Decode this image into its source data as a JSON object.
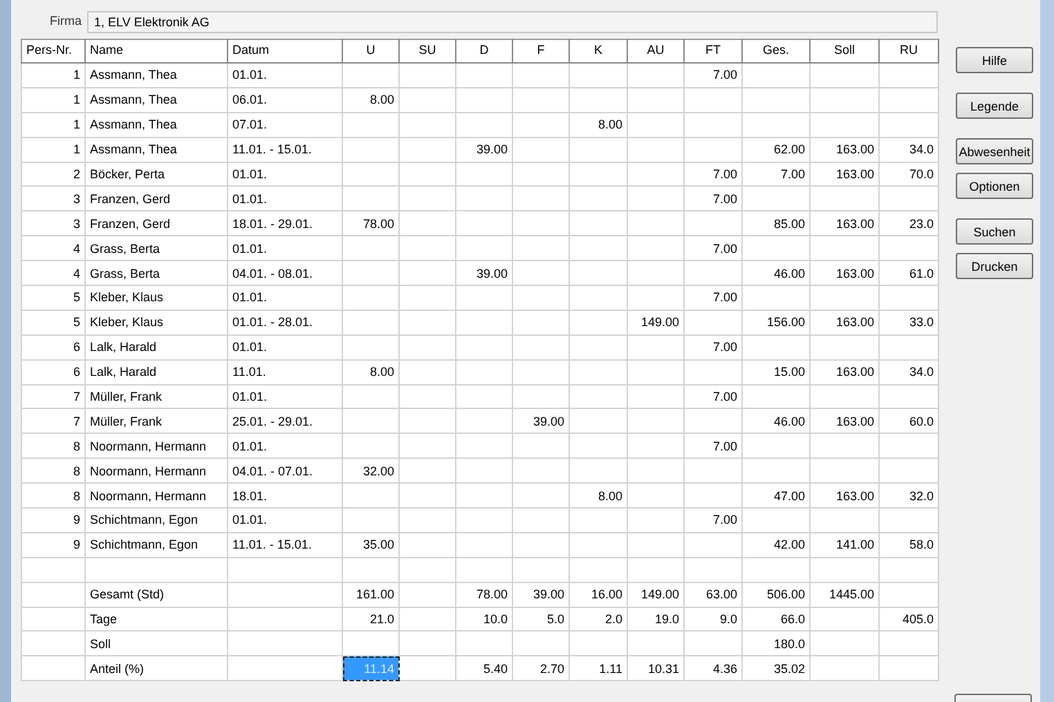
{
  "firma": {
    "label": "Firma",
    "value": "1, ELV Elektronik AG"
  },
  "table": {
    "columns": [
      "Pers-Nr.",
      "Name",
      "Datum",
      "U",
      "SU",
      "D",
      "F",
      "K",
      "AU",
      "FT",
      "Ges.",
      "Soll",
      "RU"
    ],
    "rows": [
      {
        "cells": [
          {
            "text": "1",
            "selected": false
          },
          {
            "text": "Assmann, Thea",
            "selected": false
          },
          {
            "text": "01.01.",
            "selected": false
          },
          {
            "selected": false
          },
          {
            "selected": false
          },
          {
            "selected": false
          },
          {
            "selected": false
          },
          {
            "selected": false
          },
          {
            "selected": false
          },
          {
            "text": "7.00",
            "selected": false
          },
          {
            "selected": false
          },
          {
            "selected": false
          },
          {
            "selected": false
          }
        ]
      },
      {
        "cells": [
          {
            "text": "1",
            "selected": false
          },
          {
            "text": "Assmann, Thea",
            "selected": false
          },
          {
            "text": "06.01.",
            "selected": false
          },
          {
            "text": "8.00",
            "selected": false
          },
          {
            "selected": false
          },
          {
            "selected": false
          },
          {
            "selected": false
          },
          {
            "selected": false
          },
          {
            "selected": false
          },
          {
            "selected": false
          },
          {
            "selected": false
          },
          {
            "selected": false
          },
          {
            "selected": false
          }
        ]
      },
      {
        "cells": [
          {
            "text": "1",
            "selected": false
          },
          {
            "text": "Assmann, Thea",
            "selected": false
          },
          {
            "text": "07.01.",
            "selected": false
          },
          {
            "selected": false
          },
          {
            "selected": false
          },
          {
            "selected": false
          },
          {
            "selected": false
          },
          {
            "text": "8.00",
            "selected": false
          },
          {
            "selected": false
          },
          {
            "selected": false
          },
          {
            "selected": false
          },
          {
            "selected": false
          },
          {
            "selected": false
          }
        ]
      },
      {
        "cells": [
          {
            "text": "1",
            "selected": false
          },
          {
            "text": "Assmann, Thea",
            "selected": false
          },
          {
            "text": "11.01. - 15.01.",
            "selected": false
          },
          {
            "selected": false
          },
          {
            "selected": false
          },
          {
            "text": "39.00",
            "selected": false
          },
          {
            "selected": false
          },
          {
            "selected": false
          },
          {
            "selected": false
          },
          {
            "selected": false
          },
          {
            "text": "62.00",
            "selected": false
          },
          {
            "text": "163.00",
            "selected": false
          },
          {
            "text": "34.0",
            "selected": false
          }
        ]
      },
      {
        "cells": [
          {
            "text": "2",
            "selected": false
          },
          {
            "text": "Böcker, Perta",
            "selected": false
          },
          {
            "text": "01.01.",
            "selected": false
          },
          {
            "selected": false
          },
          {
            "selected": false
          },
          {
            "selected": false
          },
          {
            "selected": false
          },
          {
            "selected": false
          },
          {
            "selected": false
          },
          {
            "text": "7.00",
            "selected": false
          },
          {
            "text": "7.00",
            "selected": false
          },
          {
            "text": "163.00",
            "selected": false
          },
          {
            "text": "70.0",
            "selected": false
          }
        ]
      },
      {
        "cells": [
          {
            "text": "3",
            "selected": false
          },
          {
            "text": "Franzen, Gerd",
            "selected": false
          },
          {
            "text": "01.01.",
            "selected": false
          },
          {
            "selected": false
          },
          {
            "selected": false
          },
          {
            "selected": false
          },
          {
            "selected": false
          },
          {
            "selected": false
          },
          {
            "selected": false
          },
          {
            "text": "7.00",
            "selected": false
          },
          {
            "selected": false
          },
          {
            "selected": false
          },
          {
            "selected": false
          }
        ]
      },
      {
        "cells": [
          {
            "text": "3",
            "selected": false
          },
          {
            "text": "Franzen, Gerd",
            "selected": false
          },
          {
            "text": "18.01. - 29.01.",
            "selected": false
          },
          {
            "text": "78.00",
            "selected": false
          },
          {
            "selected": false
          },
          {
            "selected": false
          },
          {
            "selected": false
          },
          {
            "selected": false
          },
          {
            "selected": false
          },
          {
            "selected": false
          },
          {
            "text": "85.00",
            "selected": false
          },
          {
            "text": "163.00",
            "selected": false
          },
          {
            "text": "23.0",
            "selected": false
          }
        ]
      },
      {
        "cells": [
          {
            "text": "4",
            "selected": false
          },
          {
            "text": "Grass, Berta",
            "selected": false
          },
          {
            "text": "01.01.",
            "selected": false
          },
          {
            "selected": false
          },
          {
            "selected": false
          },
          {
            "selected": false
          },
          {
            "selected": false
          },
          {
            "selected": false
          },
          {
            "selected": false
          },
          {
            "text": "7.00",
            "selected": false
          },
          {
            "selected": false
          },
          {
            "selected": false
          },
          {
            "selected": false
          }
        ]
      },
      {
        "cells": [
          {
            "text": "4",
            "selected": false
          },
          {
            "text": "Grass, Berta",
            "selected": false
          },
          {
            "text": "04.01. - 08.01.",
            "selected": false
          },
          {
            "selected": false
          },
          {
            "selected": false
          },
          {
            "text": "39.00",
            "selected": false
          },
          {
            "selected": false
          },
          {
            "selected": false
          },
          {
            "selected": false
          },
          {
            "selected": false
          },
          {
            "text": "46.00",
            "selected": false
          },
          {
            "text": "163.00",
            "selected": false
          },
          {
            "text": "61.0",
            "selected": false
          }
        ]
      },
      {
        "cells": [
          {
            "text": "5",
            "selected": false
          },
          {
            "text": "Kleber, Klaus",
            "selected": false
          },
          {
            "text": "01.01.",
            "selected": false
          },
          {
            "selected": false
          },
          {
            "selected": false
          },
          {
            "selected": false
          },
          {
            "selected": false
          },
          {
            "selected": false
          },
          {
            "selected": false
          },
          {
            "text": "7.00",
            "selected": false
          },
          {
            "selected": false
          },
          {
            "selected": false
          },
          {
            "selected": false
          }
        ]
      },
      {
        "cells": [
          {
            "text": "5",
            "selected": false
          },
          {
            "text": "Kleber, Klaus",
            "selected": false
          },
          {
            "text": "01.01. - 28.01.",
            "selected": false
          },
          {
            "selected": false
          },
          {
            "selected": false
          },
          {
            "selected": false
          },
          {
            "selected": false
          },
          {
            "selected": false
          },
          {
            "text": "149.00",
            "selected": false
          },
          {
            "selected": false
          },
          {
            "text": "156.00",
            "selected": false
          },
          {
            "text": "163.00",
            "selected": false
          },
          {
            "text": "33.0",
            "selected": false
          }
        ]
      },
      {
        "cells": [
          {
            "text": "6",
            "selected": false
          },
          {
            "text": "Lalk, Harald",
            "selected": false
          },
          {
            "text": "01.01.",
            "selected": false
          },
          {
            "selected": false
          },
          {
            "selected": false
          },
          {
            "selected": false
          },
          {
            "selected": false
          },
          {
            "selected": false
          },
          {
            "selected": false
          },
          {
            "text": "7.00",
            "selected": false
          },
          {
            "selected": false
          },
          {
            "selected": false
          },
          {
            "selected": false
          }
        ]
      },
      {
        "cells": [
          {
            "text": "6",
            "selected": false
          },
          {
            "text": "Lalk, Harald",
            "selected": false
          },
          {
            "text": "11.01.",
            "selected": false
          },
          {
            "text": "8.00",
            "selected": false
          },
          {
            "selected": false
          },
          {
            "selected": false
          },
          {
            "selected": false
          },
          {
            "selected": false
          },
          {
            "selected": false
          },
          {
            "selected": false
          },
          {
            "text": "15.00",
            "selected": false
          },
          {
            "text": "163.00",
            "selected": false
          },
          {
            "text": "34.0",
            "selected": false
          }
        ]
      },
      {
        "cells": [
          {
            "text": "7",
            "selected": false
          },
          {
            "text": "Müller, Frank",
            "selected": false
          },
          {
            "text": "01.01.",
            "selected": false
          },
          {
            "selected": false
          },
          {
            "selected": false
          },
          {
            "selected": false
          },
          {
            "selected": false
          },
          {
            "selected": false
          },
          {
            "selected": false
          },
          {
            "text": "7.00",
            "selected": false
          },
          {
            "selected": false
          },
          {
            "selected": false
          },
          {
            "selected": false
          }
        ]
      },
      {
        "cells": [
          {
            "text": "7",
            "selected": false
          },
          {
            "text": "Müller, Frank",
            "selected": false
          },
          {
            "text": "25.01. - 29.01.",
            "selected": false
          },
          {
            "selected": false
          },
          {
            "selected": false
          },
          {
            "selected": false
          },
          {
            "text": "39.00",
            "selected": false
          },
          {
            "selected": false
          },
          {
            "selected": false
          },
          {
            "selected": false
          },
          {
            "text": "46.00",
            "selected": false
          },
          {
            "text": "163.00",
            "selected": false
          },
          {
            "text": "60.0",
            "selected": false
          }
        ]
      },
      {
        "cells": [
          {
            "text": "8",
            "selected": false
          },
          {
            "text": "Noormann, Hermann",
            "selected": false
          },
          {
            "text": "01.01.",
            "selected": false
          },
          {
            "selected": false
          },
          {
            "selected": false
          },
          {
            "selected": false
          },
          {
            "selected": false
          },
          {
            "selected": false
          },
          {
            "selected": false
          },
          {
            "text": "7.00",
            "selected": false
          },
          {
            "selected": false
          },
          {
            "selected": false
          },
          {
            "selected": false
          }
        ]
      },
      {
        "cells": [
          {
            "text": "8",
            "selected": false
          },
          {
            "text": "Noormann, Hermann",
            "selected": false
          },
          {
            "text": "04.01. - 07.01.",
            "selected": false
          },
          {
            "text": "32.00",
            "selected": false
          },
          {
            "selected": false
          },
          {
            "selected": false
          },
          {
            "selected": false
          },
          {
            "selected": false
          },
          {
            "selected": false
          },
          {
            "selected": false
          },
          {
            "selected": false
          },
          {
            "selected": false
          },
          {
            "selected": false
          }
        ]
      },
      {
        "cells": [
          {
            "text": "8",
            "selected": false
          },
          {
            "text": "Noormann, Hermann",
            "selected": false
          },
          {
            "text": "18.01.",
            "selected": false
          },
          {
            "selected": false
          },
          {
            "selected": false
          },
          {
            "selected": false
          },
          {
            "selected": false
          },
          {
            "text": "8.00",
            "selected": false
          },
          {
            "selected": false
          },
          {
            "selected": false
          },
          {
            "text": "47.00",
            "selected": false
          },
          {
            "text": "163.00",
            "selected": false
          },
          {
            "text": "32.0",
            "selected": false
          }
        ]
      },
      {
        "cells": [
          {
            "text": "9",
            "selected": false
          },
          {
            "text": "Schichtmann, Egon",
            "selected": false
          },
          {
            "text": "01.01.",
            "selected": false
          },
          {
            "selected": false
          },
          {
            "selected": false
          },
          {
            "selected": false
          },
          {
            "selected": false
          },
          {
            "selected": false
          },
          {
            "selected": false
          },
          {
            "text": "7.00",
            "selected": false
          },
          {
            "selected": false
          },
          {
            "selected": false
          },
          {
            "selected": false
          }
        ]
      },
      {
        "cells": [
          {
            "text": "9",
            "selected": false
          },
          {
            "text": "Schichtmann, Egon",
            "selected": false
          },
          {
            "text": "11.01. - 15.01.",
            "selected": false
          },
          {
            "text": "35.00",
            "selected": false
          },
          {
            "selected": false
          },
          {
            "selected": false
          },
          {
            "selected": false
          },
          {
            "selected": false
          },
          {
            "selected": false
          },
          {
            "selected": false
          },
          {
            "text": "42.00",
            "selected": false
          },
          {
            "text": "141.00",
            "selected": false
          },
          {
            "text": "58.0",
            "selected": false
          }
        ]
      },
      {
        "cells": [
          {
            "selected": false
          },
          {
            "selected": false
          },
          {
            "selected": false
          },
          {
            "selected": false
          },
          {
            "selected": false
          },
          {
            "selected": false
          },
          {
            "selected": false
          },
          {
            "selected": false
          },
          {
            "selected": false
          },
          {
            "selected": false
          },
          {
            "selected": false
          },
          {
            "selected": false
          },
          {
            "selected": false
          }
        ]
      },
      {
        "cells": [
          {
            "selected": false
          },
          {
            "text": "Gesamt (Std)",
            "selected": false
          },
          {
            "selected": false
          },
          {
            "text": "161.00",
            "selected": false
          },
          {
            "selected": false
          },
          {
            "text": "78.00",
            "selected": false
          },
          {
            "text": "39.00",
            "selected": false
          },
          {
            "text": "16.00",
            "selected": false
          },
          {
            "text": "149.00",
            "selected": false
          },
          {
            "text": "63.00",
            "selected": false
          },
          {
            "text": "506.00",
            "selected": false
          },
          {
            "text": "1445.00",
            "selected": false
          },
          {
            "selected": false
          }
        ]
      },
      {
        "cells": [
          {
            "selected": false
          },
          {
            "text": "Tage",
            "selected": false
          },
          {
            "selected": false
          },
          {
            "text": "21.0",
            "selected": false
          },
          {
            "selected": false
          },
          {
            "text": "10.0",
            "selected": false
          },
          {
            "text": "5.0",
            "selected": false
          },
          {
            "text": "2.0",
            "selected": false
          },
          {
            "text": "19.0",
            "selected": false
          },
          {
            "text": "9.0",
            "selected": false
          },
          {
            "text": "66.0",
            "selected": false
          },
          {
            "selected": false
          },
          {
            "text": "405.0",
            "selected": false
          }
        ]
      },
      {
        "cells": [
          {
            "selected": false
          },
          {
            "text": "Soll",
            "selected": false
          },
          {
            "selected": false
          },
          {
            "selected": false
          },
          {
            "selected": false
          },
          {
            "selected": false
          },
          {
            "selected": false
          },
          {
            "selected": false
          },
          {
            "selected": false
          },
          {
            "selected": false
          },
          {
            "text": "180.0",
            "selected": false
          },
          {
            "selected": false
          },
          {
            "selected": false
          }
        ]
      },
      {
        "cells": [
          {
            "selected": false
          },
          {
            "text": "Anteil (%)",
            "selected": false
          },
          {
            "selected": false
          },
          {
            "text": "11.14",
            "selected": true
          },
          {
            "selected": false
          },
          {
            "text": "5.40",
            "selected": false
          },
          {
            "text": "2.70",
            "selected": false
          },
          {
            "text": "1.11",
            "selected": false
          },
          {
            "text": "10.31",
            "selected": false
          },
          {
            "text": "4.36",
            "selected": false
          },
          {
            "text": "35.02",
            "selected": false
          },
          {
            "selected": false
          },
          {
            "selected": false
          }
        ]
      }
    ]
  },
  "buttons": [
    {
      "label": "Hilfe"
    },
    {
      "label": "Legende"
    },
    {
      "label": "Abwesenheit"
    },
    {
      "label": "Optionen"
    },
    {
      "label": "Suchen"
    },
    {
      "label": "Drucken"
    }
  ]
}
